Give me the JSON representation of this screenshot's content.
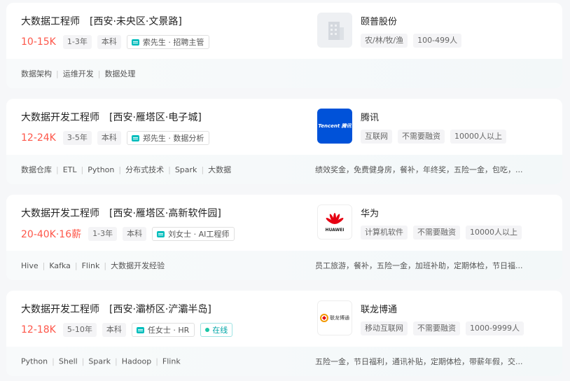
{
  "jobs": [
    {
      "title": "大数据工程师",
      "area": "[西安·未央区·文景路]",
      "salary": "10-15K",
      "experience": "1-3年",
      "degree": "本科",
      "recruiter": "索先生 · 招聘主管",
      "skills": [
        "数据架构",
        "运维开发",
        "数据处理"
      ],
      "welfare": "",
      "company": {
        "name": "颐普股份",
        "tags": [
          "农/林/牧/渔",
          "100-499人"
        ],
        "logo": "building-placeholder-icon"
      }
    },
    {
      "title": "大数据开发工程师",
      "area": "[西安·雁塔区·电子城]",
      "salary": "12-24K",
      "experience": "3-5年",
      "degree": "本科",
      "recruiter": "郑先生 · 数据分析",
      "skills": [
        "数据仓库",
        "ETL",
        "Python",
        "分布式技术",
        "Spark",
        "大数据"
      ],
      "welfare": "绩效奖金，免费健身房，餐补，年终奖，五险一金，包吃，...",
      "company": {
        "name": "腾讯",
        "tags": [
          "互联网",
          "不需要融资",
          "10000人以上"
        ],
        "logo_text": "Tencent 腾讯"
      }
    },
    {
      "title": "大数据开发工程师",
      "area": "[西安·雁塔区·高新软件园]",
      "salary": "20-40K·16薪",
      "experience": "1-3年",
      "degree": "本科",
      "recruiter": "刘女士 · AI工程师",
      "skills": [
        "Hive",
        "Kafka",
        "Flink",
        "大数据开发经验"
      ],
      "welfare": "员工旅游，餐补，五险一金，加班补助，定期体检，节日福...",
      "company": {
        "name": "华为",
        "tags": [
          "计算机软件",
          "不需要融资",
          "10000人以上"
        ],
        "logo_text": "HUAWEI"
      }
    },
    {
      "title": "大数据开发工程师",
      "area": "[西安·灞桥区·浐灞半岛]",
      "salary": "12-18K",
      "experience": "5-10年",
      "degree": "本科",
      "recruiter": "任女士 · HR",
      "online": "在线",
      "skills": [
        "Python",
        "Shell",
        "Spark",
        "Hadoop",
        "Flink"
      ],
      "welfare": "五险一金，节日福利，通讯补贴，定期体检，带薪年假，交...",
      "company": {
        "name": "联龙博通",
        "tags": [
          "移动互联网",
          "不需要融资",
          "1000-9999人"
        ],
        "logo_text": "联龙博通"
      }
    }
  ],
  "colors": {
    "salary": "#fe574a",
    "accent": "#00bebd"
  }
}
